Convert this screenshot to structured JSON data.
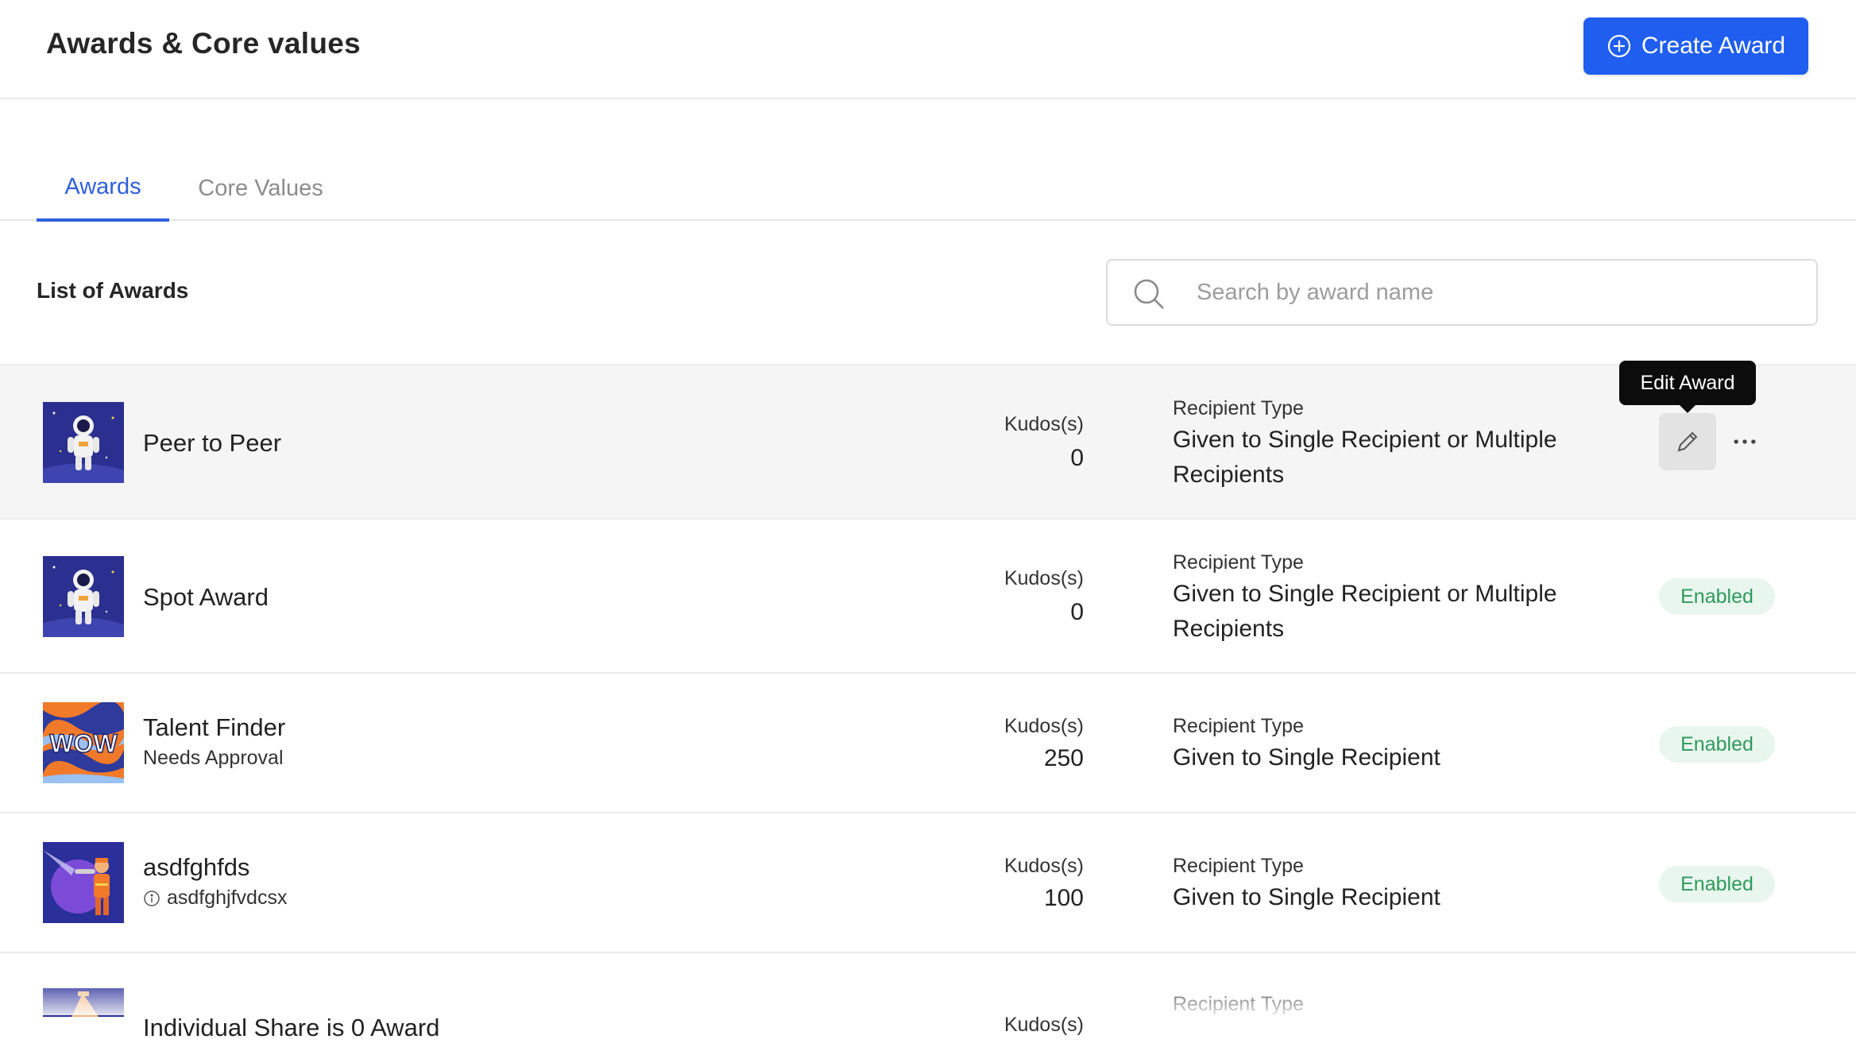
{
  "header": {
    "title": "Awards & Core values",
    "create_button_label": "Create Award"
  },
  "tabs": [
    {
      "label": "Awards",
      "active": true
    },
    {
      "label": "Core Values",
      "active": false
    }
  ],
  "list": {
    "title": "List of Awards",
    "search_placeholder": "Search by award name",
    "kudos_label": "Kudos(s)",
    "recipient_type_label": "Recipient Type",
    "tooltip": "Edit Award",
    "items": [
      {
        "name": "Peer to Peer",
        "subtitle": "",
        "kudos": "0",
        "recipient_type": "Given to Single Recipient or Multiple Recipients",
        "status": "",
        "thumb": "astronaut"
      },
      {
        "name": "Spot Award",
        "subtitle": "",
        "kudos": "0",
        "recipient_type": "Given to Single Recipient or Multiple Recipients",
        "status": "Enabled",
        "thumb": "astronaut"
      },
      {
        "name": "Talent Finder",
        "subtitle": "Needs Approval",
        "kudos": "250",
        "recipient_type": "Given to Single Recipient",
        "status": "Enabled",
        "thumb": "wow"
      },
      {
        "name": "asdfghfds",
        "subtitle": "asdfghjfvdcsx",
        "kudos": "100",
        "recipient_type": "Given to Single Recipient",
        "status": "Enabled",
        "thumb": "firefighter"
      },
      {
        "name": "Individual Share is 0 Award",
        "subtitle": "",
        "kudos": "",
        "recipient_type": "",
        "status": "",
        "thumb": "pizza"
      }
    ]
  },
  "colors": {
    "primary": "#1f5eef",
    "tab_active": "#2f5fdc",
    "enabled_bg": "#e9f6ee",
    "enabled_text": "#2f9a5b"
  }
}
